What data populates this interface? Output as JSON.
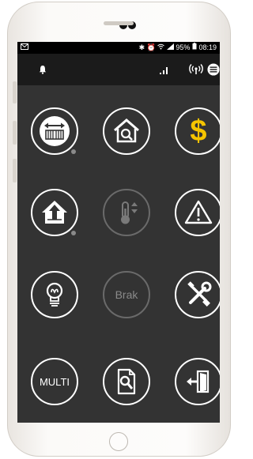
{
  "status_bar": {
    "left_icon": "mail-icon",
    "battery_text": "95%",
    "time": "08:19"
  },
  "toolbar": {
    "icons": [
      "bell-icon",
      "signal-bars-icon",
      "wireless-icon",
      "hamburger-menu-icon"
    ]
  },
  "tiles": [
    {
      "name": "gate-control",
      "icon": "gate-arrows-icon",
      "dim": false,
      "dot": true
    },
    {
      "name": "house-search",
      "icon": "house-magnifier-icon",
      "dim": false,
      "dot": false
    },
    {
      "name": "payments",
      "icon": "dollar-icon",
      "dim": false,
      "dot": false,
      "accent": "#f5c400"
    },
    {
      "name": "house-arm",
      "icon": "house-alarm-icon",
      "dim": false,
      "dot": true
    },
    {
      "name": "temperature",
      "icon": "thermometer-icon",
      "dim": true,
      "dot": false
    },
    {
      "name": "warning",
      "icon": "warning-triangle-icon",
      "dim": false,
      "dot": false
    },
    {
      "name": "lighting",
      "icon": "light-bulb-icon",
      "dim": false,
      "dot": false
    },
    {
      "name": "brak",
      "label": "Brak",
      "dim": true,
      "dot": false
    },
    {
      "name": "service-tools",
      "icon": "wrench-screwdriver-icon",
      "dim": false,
      "dot": false
    },
    {
      "name": "multi",
      "label": "MULTI",
      "dim": false,
      "dot": false
    },
    {
      "name": "document-search",
      "icon": "document-magnifier-icon",
      "dim": false,
      "dot": false
    },
    {
      "name": "exit",
      "icon": "exit-door-icon",
      "dim": false,
      "dot": false
    }
  ]
}
